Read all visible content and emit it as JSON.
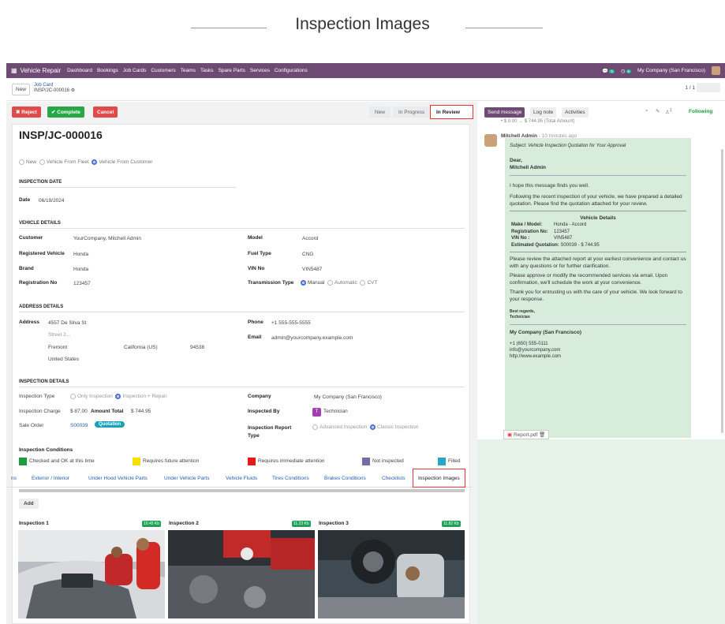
{
  "page_header": {
    "title": "Inspection Images"
  },
  "navbar": {
    "app_name": "Vehicle Repair",
    "menu": [
      "Dashboard",
      "Bookings",
      "Job Cards",
      "Customers",
      "Teams",
      "Tasks",
      "Spare Parts",
      "Services",
      "Configurations"
    ],
    "chat_count": "5",
    "activity_count": "6",
    "company": "My Company (San Francisco)"
  },
  "breadcrumb": {
    "new_label": "New",
    "parent": "Job Card",
    "record": "INSP/JC-000016",
    "pager": "1 / 1"
  },
  "actions": {
    "reject": "✖ Reject",
    "complete": "✔ Complete",
    "cancel": "Cancel"
  },
  "stages": [
    "New",
    "In Progress",
    "In Review"
  ],
  "record": {
    "title": "INSP/JC-000016",
    "vehicle_source": [
      "New",
      "Vehicle From Fleet",
      "Vehicle From Customer"
    ],
    "inspection_date_section": "INSPECTION DATE",
    "date_label": "Date",
    "date_value": "06/19/2024",
    "vehicle_section": "VEHICLE DETAILS",
    "customer_label": "Customer",
    "customer_value": "YourCompany, Mitchell Admin",
    "registered_vehicle_label": "Registered Vehicle",
    "registered_vehicle_value": "Honda",
    "brand_label": "Brand",
    "brand_value": "Honda",
    "registration_label": "Registration No",
    "registration_value": "123457",
    "model_label": "Model",
    "model_value": "Accord",
    "fuel_label": "Fuel Type",
    "fuel_value": "CNG",
    "vin_label": "VIN No",
    "vin_value": "VIN5487",
    "transmission_label": "Transmission Type",
    "transmission_options": [
      "Manual",
      "Automatic",
      "CVT"
    ],
    "address_section": "ADDRESS DETAILS",
    "address_label": "Address",
    "address_street": "4557 De Silva St",
    "address_street2": "Street 2...",
    "address_city": "Fremont",
    "address_state": "California (US)",
    "address_zip": "94538",
    "address_country": "United States",
    "phone_label": "Phone",
    "phone_value": "+1 555-555-5555",
    "email_label": "Email",
    "email_value": "admin@yourcompany.example.com",
    "inspection_section": "INSPECTION DETAILS",
    "inspection_type_label": "Inspection Type",
    "inspection_type_options": [
      "Only Inspection",
      "Inspection + Repair"
    ],
    "charge_label": "Inspection Charge",
    "charge_value": "$ 87.00",
    "amount_total_label": "Amount Total",
    "amount_total_value": "$ 744.95",
    "sale_order_label": "Sale Order",
    "sale_order_value": "S00039",
    "sale_order_badge": "Quotation",
    "company_label": "Company",
    "company_value": "My Company (San Francisco)",
    "inspected_by_label": "Inspected By",
    "inspected_by_initial": "T",
    "inspected_by_value": "Technician",
    "report_type_label": "Inspection Report Type",
    "report_type_options": [
      "Advanced Inspection",
      "Classic Inspection"
    ],
    "conditions_title": "Inspection Conditions",
    "conditions": [
      {
        "label": "Checked and OK at this time",
        "color": "#1e9b3e"
      },
      {
        "label": "Requires future attention",
        "color": "#f5e000"
      },
      {
        "label": "Requires immediate attention",
        "color": "#e51919"
      },
      {
        "label": "Not inspected",
        "color": "#7a6aa6"
      },
      {
        "label": "Filled",
        "color": "#2ba3c8"
      }
    ]
  },
  "tabs": [
    "ns",
    "Exterior / Interior",
    "Under Hood Vehicle Parts",
    "Under Vehicle Parts",
    "Vehicle Fluids",
    "Tires Conditions",
    "Brakes Conditions",
    "Checklists",
    "Inspection Images"
  ],
  "images_tab": {
    "add_label": "Add",
    "cards": [
      {
        "title": "Inspection 1",
        "size": "10.45 Kb"
      },
      {
        "title": "Inspection 2",
        "size": "11.23 Kb"
      },
      {
        "title": "Inspection 3",
        "size": "11.82 Kb"
      }
    ]
  },
  "chatter": {
    "send_message": "Send message",
    "log_note": "Log note",
    "activities": "Activities",
    "followers_count": "1",
    "following": "Following",
    "top_line": "• $ 0.00 → $ 744.95 (Total Amount)",
    "author": "Mitchell Admin",
    "time": "- 10 minutes ago",
    "subject": "Subject: Vehicle Inspection Quotation for Your Approval",
    "greeting": "Dear,",
    "greeting_name": "Mitchell Admin",
    "p1": "I hope this message finds you well.",
    "p2": "Following the recent inspection of your vehicle, we have prepared a detailed quotation. Please find the quotation attached for your review.",
    "details_title": "Vehicle Details",
    "make_label": "Make / Model:",
    "make_value": "Honda - Accord",
    "reg_label": "Registration No:",
    "reg_value": "123457",
    "vin_label": "VIN No :",
    "vin_value": "VIN5487",
    "quote_label": "Estimated Quotation:",
    "quote_value": "S00039 - $ 744.95",
    "p3": "Please review the attached report at your earliest convenience and contact us with any questions or for further clarification.",
    "p4": "Please approve or modify the recommended services via email. Upon confirmation, we'll schedule the work at your convenience.",
    "p5": "Thank you for entrusting us with the care of your vehicle. We look forward to your response.",
    "regards": "Best regards,",
    "signature": "Technician",
    "company": "My Company (San Francisco)",
    "phone": "+1 (650) 555-0111",
    "email": "info@yourcompany.com",
    "web": "http://www.example.com",
    "attachment": "Report.pdf"
  }
}
